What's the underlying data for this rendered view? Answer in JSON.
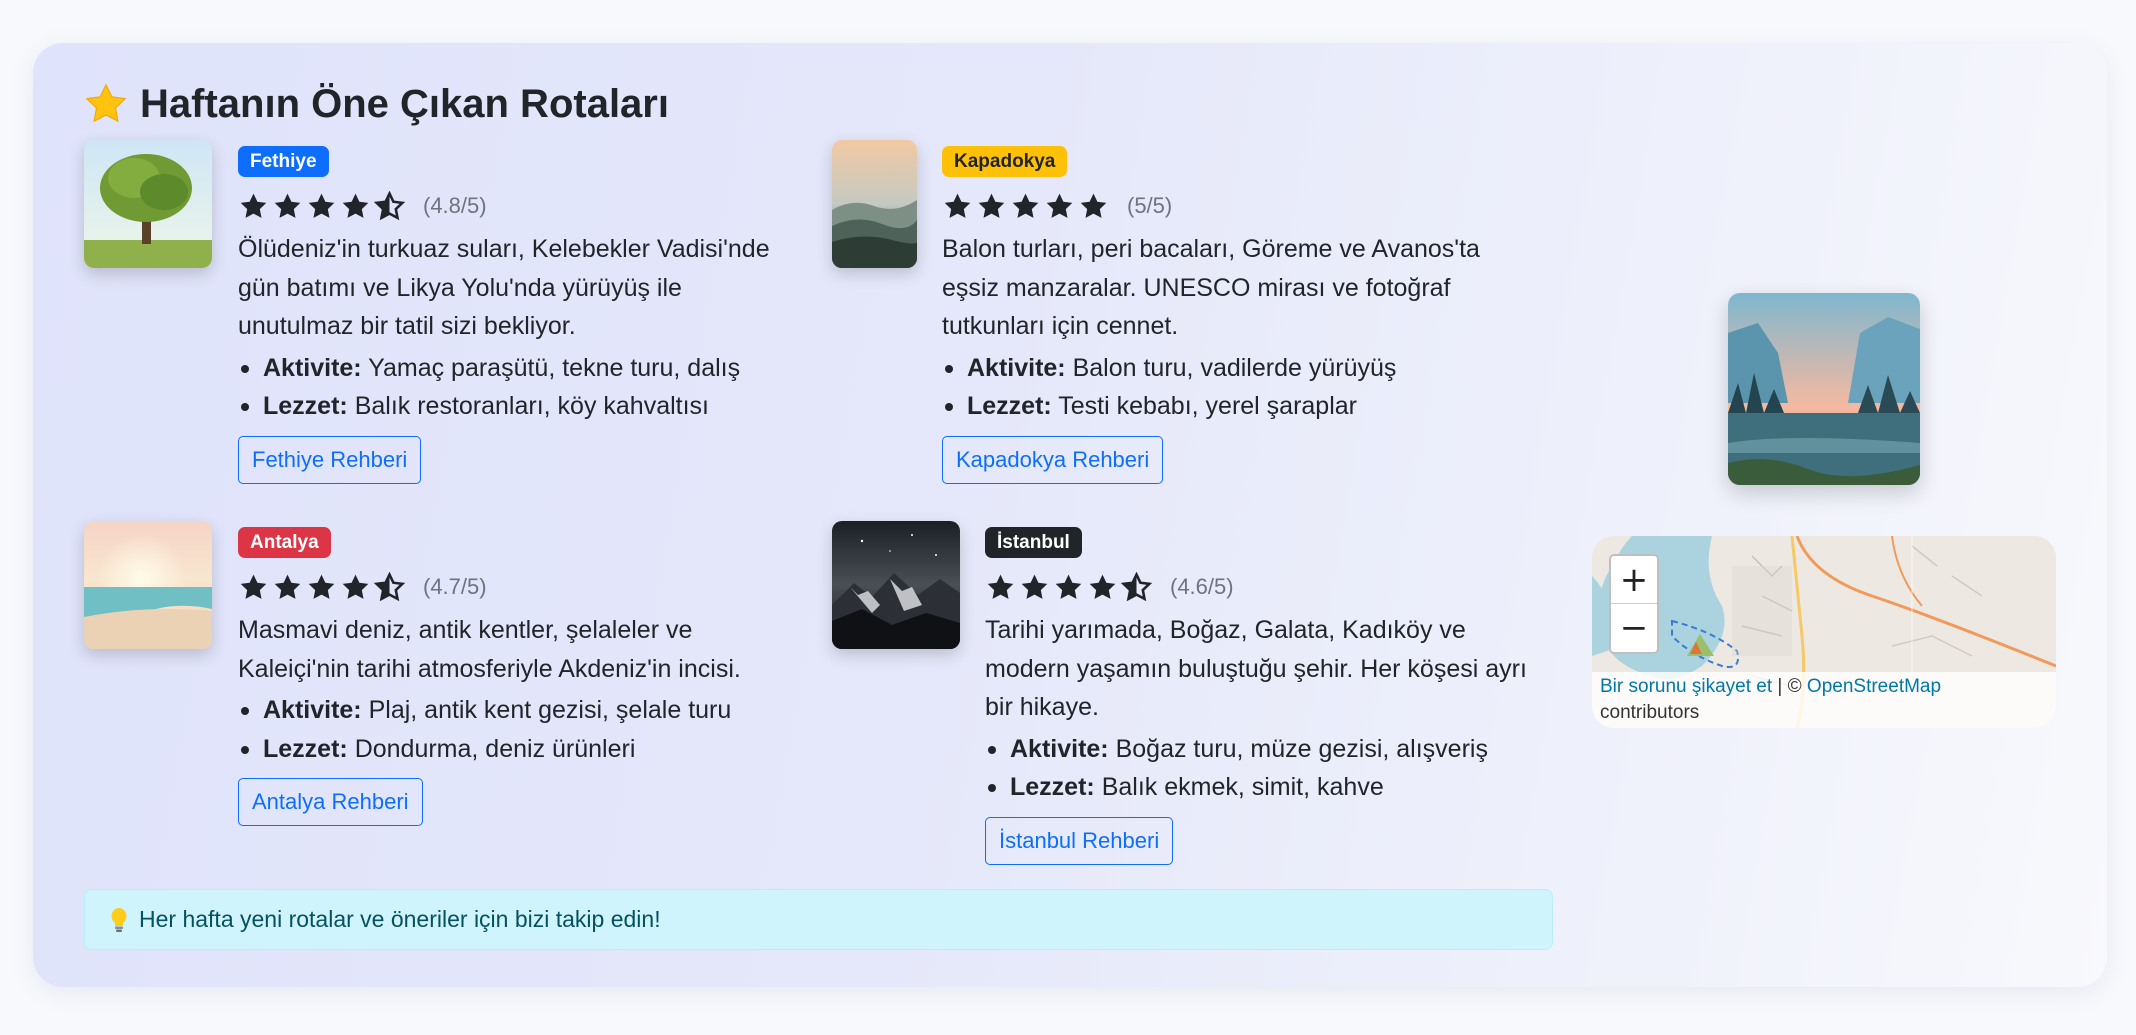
{
  "section_title": "Haftanın Öne Çıkan Rotaları",
  "routes": [
    {
      "badge": "Fethiye",
      "badge_color": "#0d6efd",
      "badge_text_color": "#ffffff",
      "rating": 4.5,
      "rating_text": "(4.8/5)",
      "description": "Ölüdeniz'in turkuaz suları, Kelebekler Vadisi'nde gün batımı ve Likya Yolu'nda yürüyüş ile unutulmaz bir tatil sizi bekliyor.",
      "activity_label": "Aktivite:",
      "activity": "Yamaç paraşütü, tekne turu, dalış",
      "food_label": "Lezzet:",
      "food": "Balık restoranları, köy kahvaltısı",
      "button": "Fethiye Rehberi",
      "photo": "tree-photo"
    },
    {
      "badge": "Kapadokya",
      "badge_color": "#ffc107",
      "badge_text_color": "#212529",
      "rating": 5,
      "rating_text": "(5/5)",
      "description": "Balon turları, peri bacaları, Göreme ve Avanos'ta eşsiz manzaralar. UNESCO mirası ve fotoğraf tutkunları için cennet.",
      "activity_label": "Aktivite:",
      "activity": "Balon turu, vadilerde yürüyüş",
      "food_label": "Lezzet:",
      "food": "Testi kebabı, yerel şaraplar",
      "button": "Kapadokya Rehberi",
      "photo": "misty-hills-photo"
    },
    {
      "badge": "Antalya",
      "badge_color": "#dc3545",
      "badge_text_color": "#ffffff",
      "rating": 4.5,
      "rating_text": "(4.7/5)",
      "description": "Masmavi deniz, antik kentler, şelaleler ve Kaleiçi'nin tarihi atmosferiyle Akdeniz'in incisi.",
      "activity_label": "Aktivite:",
      "activity": "Plaj, antik kent gezisi, şelale turu",
      "food_label": "Lezzet:",
      "food": "Dondurma, deniz ürünleri",
      "button": "Antalya Rehberi",
      "photo": "beach-sunset-photo"
    },
    {
      "badge": "İstanbul",
      "badge_color": "#212529",
      "badge_text_color": "#ffffff",
      "rating": 4.5,
      "rating_text": "(4.6/5)",
      "description": "Tarihi yarımada, Boğaz, Galata, Kadıköy ve modern yaşamın buluştuğu şehir. Her köşesi ayrı bir hikaye.",
      "activity_label": "Aktivite:",
      "activity": "Boğaz turu, müze gezisi, alışveriş",
      "food_label": "Lezzet:",
      "food": "Balık ekmek, simit, kahve",
      "button": "İstanbul Rehberi",
      "photo": "night-mountains-photo"
    }
  ],
  "tip": "Her hafta yeni rotalar ve öneriler için bizi takip edin!",
  "map": {
    "zoom_in": "+",
    "zoom_out": "−",
    "report_link": "Bir sorunu şikayet et",
    "separator": " | © ",
    "osm_link": "OpenStreetMap",
    "contributors": "contributors"
  }
}
